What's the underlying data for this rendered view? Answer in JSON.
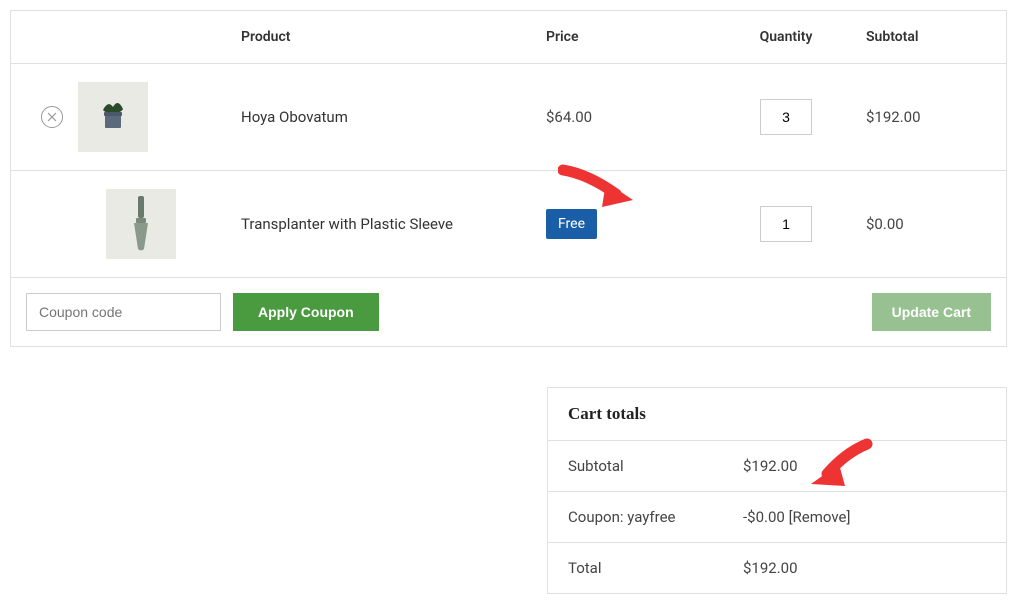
{
  "headers": {
    "product": "Product",
    "price": "Price",
    "quantity": "Quantity",
    "subtotal": "Subtotal"
  },
  "items": [
    {
      "name": "Hoya Obovatum",
      "price": "$64.00",
      "qty": "3",
      "subtotal": "$192.00",
      "removable": true,
      "free": false
    },
    {
      "name": "Transplanter with Plastic Sleeve",
      "price": "Free",
      "qty": "1",
      "subtotal": "$0.00",
      "removable": false,
      "free": true
    }
  ],
  "coupon": {
    "placeholder": "Coupon code",
    "apply": "Apply Coupon",
    "update": "Update Cart"
  },
  "totals": {
    "title": "Cart totals",
    "subtotal_label": "Subtotal",
    "subtotal_value": "$192.00",
    "coupon_label": "Coupon: yayfree",
    "coupon_value": "-$0.00",
    "remove": "[Remove]",
    "total_label": "Total",
    "total_value": "$192.00"
  }
}
